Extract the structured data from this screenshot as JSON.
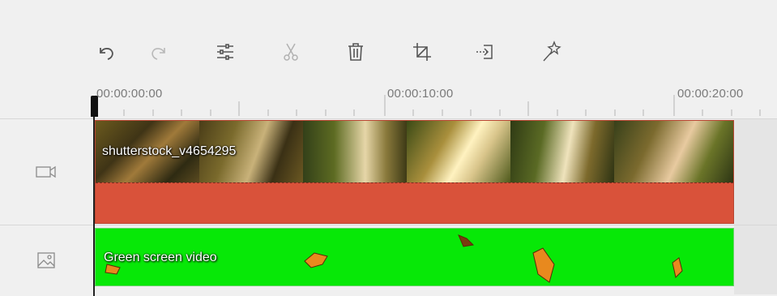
{
  "toolbar": {
    "buttons": [
      {
        "name": "undo-button",
        "icon": "undo-icon",
        "enabled": true
      },
      {
        "name": "redo-button",
        "icon": "redo-icon",
        "enabled": false
      },
      {
        "name": "adjust-button",
        "icon": "sliders-icon",
        "enabled": true
      },
      {
        "name": "cut-button",
        "icon": "scissors-icon",
        "enabled": false
      },
      {
        "name": "delete-button",
        "icon": "trash-icon",
        "enabled": true
      },
      {
        "name": "crop-button",
        "icon": "crop-icon",
        "enabled": true
      },
      {
        "name": "export-button",
        "icon": "export-icon",
        "enabled": true
      },
      {
        "name": "magic-button",
        "icon": "magic-wand-icon",
        "enabled": true
      }
    ]
  },
  "ruler": {
    "labels": [
      "00:00:00:00",
      "00:00:10:00",
      "00:00:20:00"
    ]
  },
  "tracks": {
    "video": {
      "icon": "video-camera-icon",
      "clip_title": "shutterstock_v4654295",
      "color": "#d9523a"
    },
    "image": {
      "icon": "image-icon",
      "clip_title": "Green screen video",
      "color": "#07e807"
    }
  }
}
